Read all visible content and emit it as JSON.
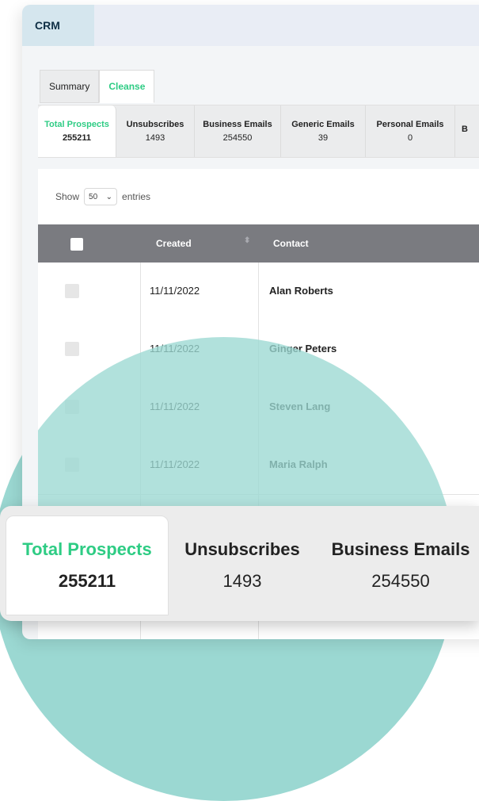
{
  "app": {
    "title": "CRM"
  },
  "tabs": [
    {
      "label": "Summary",
      "active": false
    },
    {
      "label": "Cleanse",
      "active": true
    }
  ],
  "stats": [
    {
      "label": "Total Prospects",
      "value": "255211",
      "active": true
    },
    {
      "label": "Unsubscribes",
      "value": "1493"
    },
    {
      "label": "Business Emails",
      "value": "254550"
    },
    {
      "label": "Generic Emails",
      "value": "39"
    },
    {
      "label": "Personal Emails",
      "value": "0"
    },
    {
      "label": "B",
      "value": ""
    }
  ],
  "table_controls": {
    "show_label": "Show",
    "page_size": "50",
    "entries_label": "entries"
  },
  "table": {
    "columns": [
      "Created",
      "Contact"
    ],
    "rows": [
      {
        "created": "11/11/2022",
        "contact": "Alan Roberts"
      },
      {
        "created": "11/11/2022",
        "contact": "Ginger Peters"
      },
      {
        "created": "11/11/2022",
        "contact": "Steven Lang"
      },
      {
        "created": "11/11/2022",
        "contact": "Maria Ralph"
      }
    ]
  },
  "zoom": {
    "stats": [
      {
        "label": "Total Prospects",
        "value": "255211"
      },
      {
        "label": "Unsubscribes",
        "value": "1493"
      },
      {
        "label": "Business Emails",
        "value": "254550"
      }
    ]
  },
  "colors": {
    "accent": "#2ecc84",
    "teal": "#9bd8d2",
    "header": "#7a7b80",
    "brand_text": "#0f2f45"
  }
}
